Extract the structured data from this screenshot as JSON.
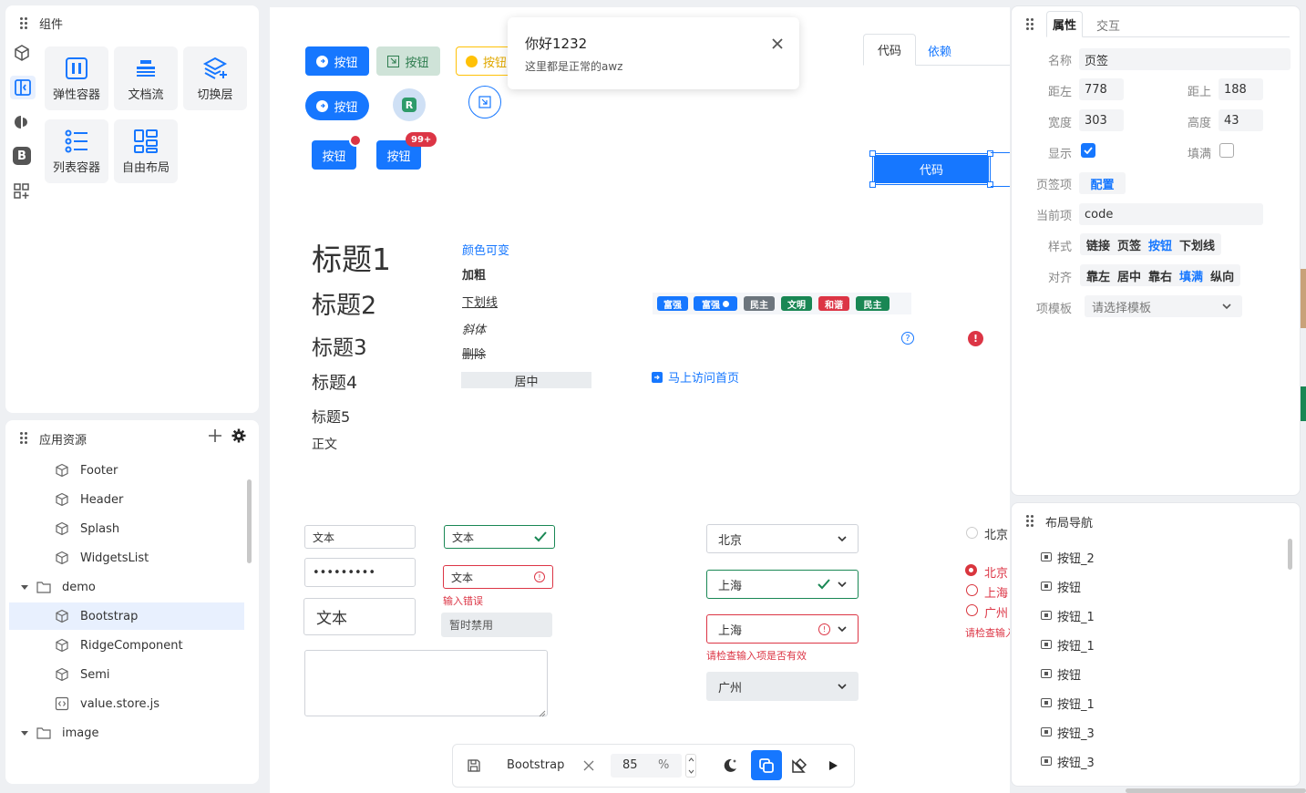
{
  "components_panel": {
    "title": "组件",
    "tiles": [
      {
        "label": "弹性容器",
        "icon": "flex-container-icon"
      },
      {
        "label": "文档流",
        "icon": "doc-flow-icon"
      },
      {
        "label": "切换层",
        "icon": "layers-icon"
      },
      {
        "label": "列表容器",
        "icon": "list-container-icon"
      },
      {
        "label": "自由布局",
        "icon": "free-layout-icon"
      }
    ],
    "side_icons": [
      "cube-icon",
      "panel-icon",
      "semi-icon",
      "bootstrap-icon",
      "grid-plus-icon"
    ]
  },
  "resources_panel": {
    "title": "应用资源",
    "items": [
      {
        "label": "Footer",
        "type": "component"
      },
      {
        "label": "Header",
        "type": "component"
      },
      {
        "label": "Splash",
        "type": "component"
      },
      {
        "label": "WidgetsList",
        "type": "component"
      },
      {
        "label": "demo",
        "type": "folder"
      },
      {
        "label": "Bootstrap",
        "type": "component",
        "active": true
      },
      {
        "label": "RidgeComponent",
        "type": "component"
      },
      {
        "label": "Semi",
        "type": "component"
      },
      {
        "label": "value.store.js",
        "type": "file"
      },
      {
        "label": "image",
        "type": "folder"
      }
    ]
  },
  "canvas": {
    "buttons": {
      "b1": "按钮",
      "b2": "按钮",
      "b3": "按钮",
      "b4": "按钮",
      "b5": "按钮",
      "b6": "按钮",
      "avatar_letter": "R",
      "badge_count": "99+"
    },
    "toast": {
      "title": "你好1232",
      "message": "这里都是正常的awz"
    },
    "tabs": {
      "code": "代码",
      "deps": "依赖"
    },
    "selected_button": "代码",
    "headings": [
      "标题1",
      "标题2",
      "标题3",
      "标题4",
      "标题5",
      "正文"
    ],
    "text_styles": {
      "color": "颜色可变",
      "bold": "加粗",
      "underline": "下划线",
      "italic": "斜体",
      "strike": "删除",
      "center": "居中"
    },
    "tags": [
      {
        "label": "富强",
        "color": "#1677ff"
      },
      {
        "label": "富强",
        "color": "#1677ff",
        "dot": true
      },
      {
        "label": "民主",
        "color": "#6c757d"
      },
      {
        "label": "文明",
        "color": "#198754"
      },
      {
        "label": "和谐",
        "color": "#dc3545"
      },
      {
        "label": "民主",
        "color": "#198754"
      }
    ],
    "link": "马上访问首页",
    "inputs": {
      "text1": "文本",
      "password": "•••••••••",
      "text_large": "文本",
      "valid": "文本",
      "invalid": "文本",
      "error_msg": "输入错误",
      "disabled": "暂时禁用"
    },
    "selects": {
      "s1": "北京",
      "s2": "上海",
      "s3": "上海",
      "s3_error": "请检查输入项是否有效",
      "s4": "广州"
    },
    "radios": {
      "r0": "北京",
      "r1": "北京",
      "r2": "上海",
      "r3": "广州",
      "error": "请检查输入"
    }
  },
  "bottom_toolbar": {
    "name": "Bootstrap",
    "zoom": "85",
    "unit": "%"
  },
  "props_panel": {
    "tabs": [
      "属性",
      "交互"
    ],
    "name_label": "名称",
    "name_value": "页签",
    "left_label": "距左",
    "left_value": "778",
    "top_label": "距上",
    "top_value": "188",
    "width_label": "宽度",
    "width_value": "303",
    "height_label": "高度",
    "height_value": "43",
    "show_label": "显示",
    "fill_label": "填满",
    "tabitems_label": "页签项",
    "tabitems_value": "配置",
    "current_label": "当前项",
    "current_value": "code",
    "style_label": "样式",
    "style_options": [
      "链接",
      "页签",
      "按钮",
      "下划线"
    ],
    "style_selected": 2,
    "align_label": "对齐",
    "align_options": [
      "靠左",
      "居中",
      "靠右",
      "填满",
      "纵向"
    ],
    "align_selected": 3,
    "template_label": "项模板",
    "template_placeholder": "请选择模板"
  },
  "layout_nav": {
    "title": "布局导航",
    "items": [
      "按钮_2",
      "按钮",
      "按钮_1",
      "按钮_1",
      "按钮",
      "按钮_1",
      "按钮_3",
      "按钮_3"
    ]
  }
}
